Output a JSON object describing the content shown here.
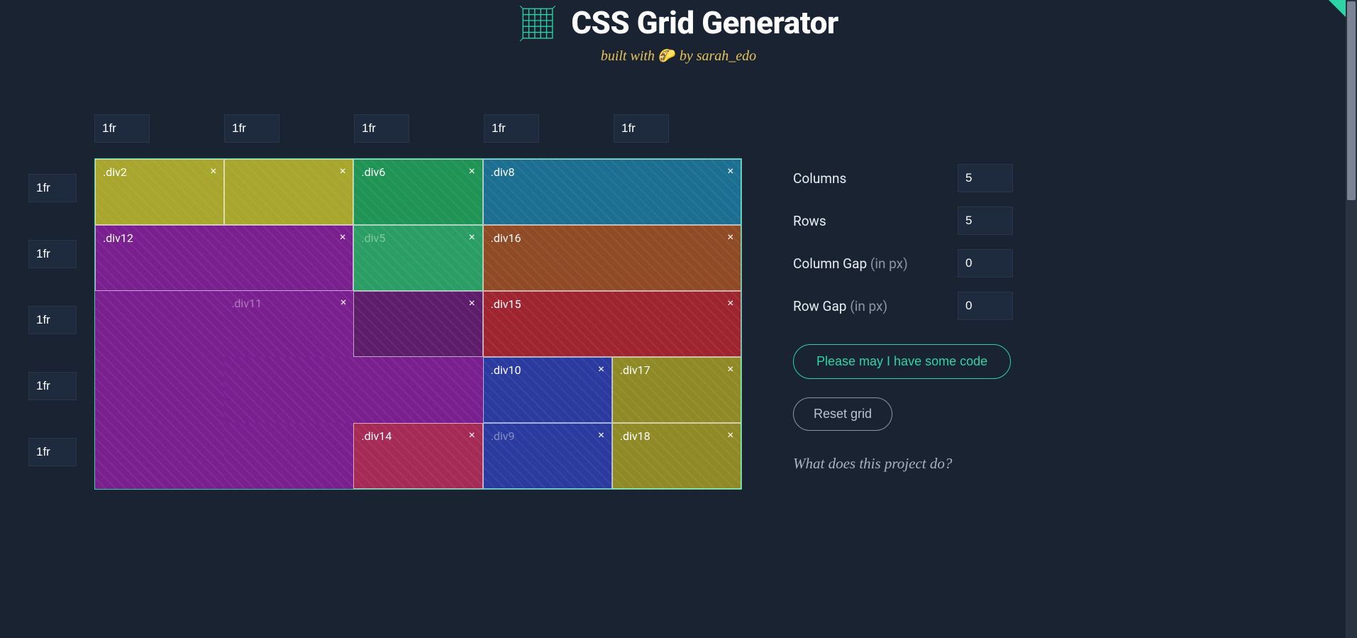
{
  "header": {
    "title": "CSS Grid Generator",
    "subtitle_prefix": "built with ",
    "taco": "🌮",
    "subtitle_mid": " by ",
    "author": "sarah_edo"
  },
  "columns": [
    "1fr",
    "1fr",
    "1fr",
    "1fr",
    "1fr"
  ],
  "rows": [
    "1fr",
    "1fr",
    "1fr",
    "1fr",
    "1fr"
  ],
  "grid": {
    "cols": 5,
    "rows": 5
  },
  "placed": [
    {
      "label": ".div2",
      "col": 1,
      "row": 1,
      "w": 1,
      "h": 1,
      "color": "#a8a62c",
      "faded": false
    },
    {
      "label": "",
      "col": 2,
      "row": 1,
      "w": 1,
      "h": 1,
      "color": "#a8a62c",
      "faded": false,
      "close_only": true
    },
    {
      "label": ".div6",
      "col": 3,
      "row": 1,
      "w": 1,
      "h": 1,
      "color": "#1f9455",
      "faded": false
    },
    {
      "label": ".div8",
      "col": 4,
      "row": 1,
      "w": 2,
      "h": 1,
      "color": "#1c6f91",
      "faded": false
    },
    {
      "label": ".div12",
      "col": 1,
      "row": 2,
      "w": 2,
      "h": 1,
      "color": "#7a1f8f",
      "faded": false
    },
    {
      "label": ".div5",
      "col": 3,
      "row": 2,
      "w": 1,
      "h": 1,
      "color": "#2a9e64",
      "faded": true
    },
    {
      "label": ".div16",
      "col": 4,
      "row": 2,
      "w": 2,
      "h": 1,
      "color": "#8f4a26",
      "faded": false
    },
    {
      "label": ".div11",
      "col": 2,
      "row": 3,
      "w": 1,
      "h": 1,
      "color": "#7a1f8f",
      "faded": true,
      "no_border": true
    },
    {
      "label": "",
      "col": 3,
      "row": 3,
      "w": 1,
      "h": 1,
      "color": "#5e1d6b",
      "faded": false,
      "close_only": true
    },
    {
      "label": ".div15",
      "col": 4,
      "row": 3,
      "w": 2,
      "h": 1,
      "color": "#9e2530",
      "faded": false
    },
    {
      "label": "",
      "col": 1,
      "row": 3,
      "w": 1,
      "h": 3,
      "color": "#7a1f8f",
      "faded": false,
      "bg_only": true
    },
    {
      "label": "",
      "col": 2,
      "row": 4,
      "w": 2,
      "h": 1,
      "color": "#7a1f8f",
      "faded": false,
      "bg_only": true
    },
    {
      "label": ".div10",
      "col": 4,
      "row": 4,
      "w": 1,
      "h": 1,
      "color": "#2a3a9e",
      "faded": false
    },
    {
      "label": ".div17",
      "col": 5,
      "row": 4,
      "w": 1,
      "h": 1,
      "color": "#8f8a26",
      "faded": false
    },
    {
      "label": "",
      "col": 2,
      "row": 5,
      "w": 1,
      "h": 1,
      "color": "#7a1f8f",
      "faded": false,
      "bg_only": true
    },
    {
      "label": ".div14",
      "col": 3,
      "row": 5,
      "w": 1,
      "h": 1,
      "color": "#a52a55",
      "faded": false
    },
    {
      "label": ".div9",
      "col": 4,
      "row": 5,
      "w": 1,
      "h": 1,
      "color": "#2a3a9e",
      "faded": true
    },
    {
      "label": ".div18",
      "col": 5,
      "row": 5,
      "w": 1,
      "h": 1,
      "color": "#8f8a26",
      "faded": false
    }
  ],
  "controls": {
    "columns_label": "Columns",
    "columns_value": "5",
    "rows_label": "Rows",
    "rows_value": "5",
    "colgap_label": "Column Gap ",
    "colgap_hint": "(in px)",
    "colgap_value": "0",
    "rowgap_label": "Row Gap ",
    "rowgap_hint": "(in px)",
    "rowgap_value": "0"
  },
  "buttons": {
    "code": "Please may I have some code",
    "reset": "Reset grid"
  },
  "info_link": "What does this project do?"
}
